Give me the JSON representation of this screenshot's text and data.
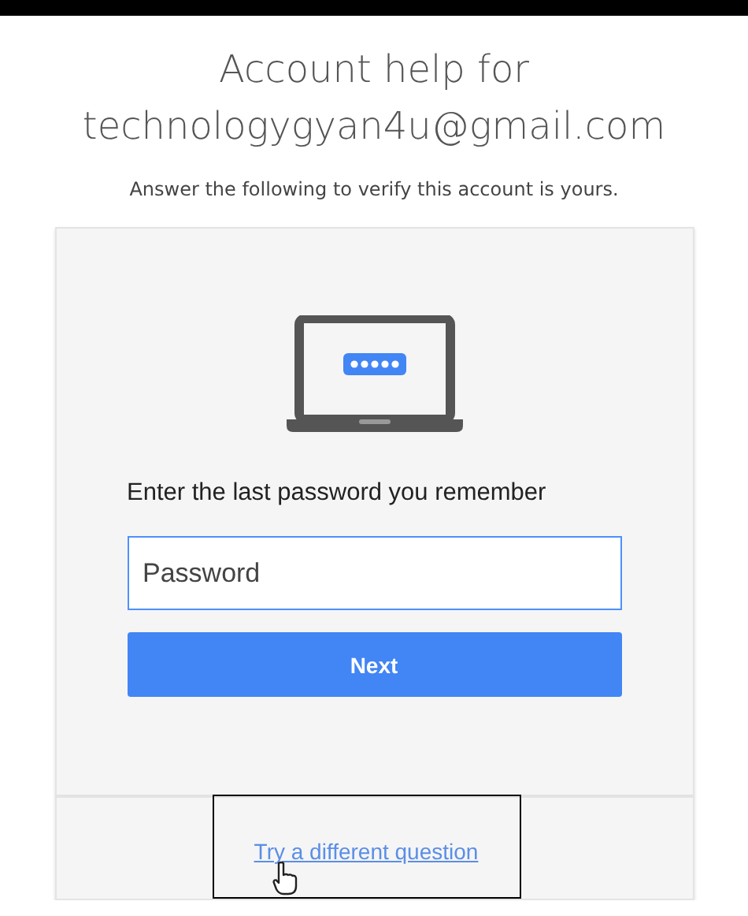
{
  "heading": {
    "line_1": "Account help for",
    "line_2": "technologygyan4u@gmail.com"
  },
  "subtitle": "Answer the following to verify this account is yours.",
  "card": {
    "prompt": "Enter the last password you remember",
    "password": {
      "placeholder": "Password"
    },
    "button": "Next",
    "link": "Try a different question"
  }
}
